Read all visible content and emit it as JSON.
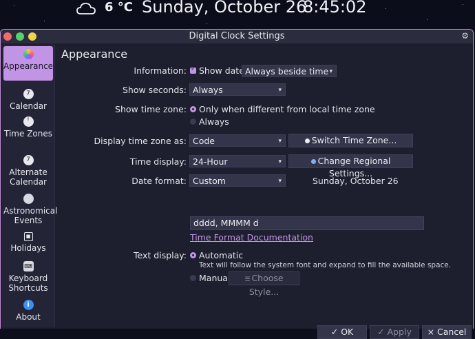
{
  "top_bar": {
    "weather_icon": "cloud-icon",
    "temperature": "6 °C",
    "date": "Sunday, October 26",
    "time": "8:45:02"
  },
  "window": {
    "title": "Digital Clock Settings",
    "settings_icon": "gear-icon"
  },
  "sidebar": {
    "items": [
      {
        "label": "Appearance",
        "icon": "appearance-icon",
        "active": true
      },
      {
        "label": "Calendar",
        "icon": "calendar-icon"
      },
      {
        "label": "Time Zones",
        "icon": "clock-icon"
      },
      {
        "label": "Alternate Calendar",
        "icon": "calendar-icon"
      },
      {
        "label": "Astronomical Events",
        "icon": "moon-icon"
      },
      {
        "label": "Holidays",
        "icon": "holidays-icon"
      },
      {
        "label": "Keyboard Shortcuts",
        "icon": "keyboard-icon"
      },
      {
        "label": "About",
        "icon": "info-icon"
      }
    ]
  },
  "page": {
    "title": "Appearance",
    "information": {
      "label": "Information:",
      "checkbox_label": "Show date",
      "checked": true,
      "select_value": "Always beside time"
    },
    "show_seconds": {
      "label": "Show seconds:",
      "value": "Always"
    },
    "show_time_zone": {
      "label": "Show time zone:",
      "option_1": "Only when different from local time zone",
      "option_2": "Always",
      "selected": "option_1"
    },
    "display_time_zone": {
      "label": "Display time zone as:",
      "value": "Code",
      "button": "Switch Time Zone..."
    },
    "time_display": {
      "label": "Time display:",
      "value": "24-Hour",
      "button": "Change Regional Settings..."
    },
    "date_format": {
      "label": "Date format:",
      "value": "Custom",
      "preview": "Sunday, October 26",
      "format_string": "dddd, MMMM d",
      "doc_link": "Time Format Documentation"
    },
    "text_display": {
      "label": "Text display:",
      "option_automatic": "Automatic",
      "automatic_hint": "Text will follow the system font and expand to fill the available space.",
      "option_manual": "Manual",
      "choose_style_button": "Choose Style...",
      "selected": "automatic"
    }
  },
  "footer": {
    "ok": "✓ OK",
    "apply": "✓ Apply",
    "cancel": "× Cancel"
  },
  "colors": {
    "accent": "#c294e6",
    "window_bg": "#1e1f2e",
    "control_bg": "#34354a"
  }
}
